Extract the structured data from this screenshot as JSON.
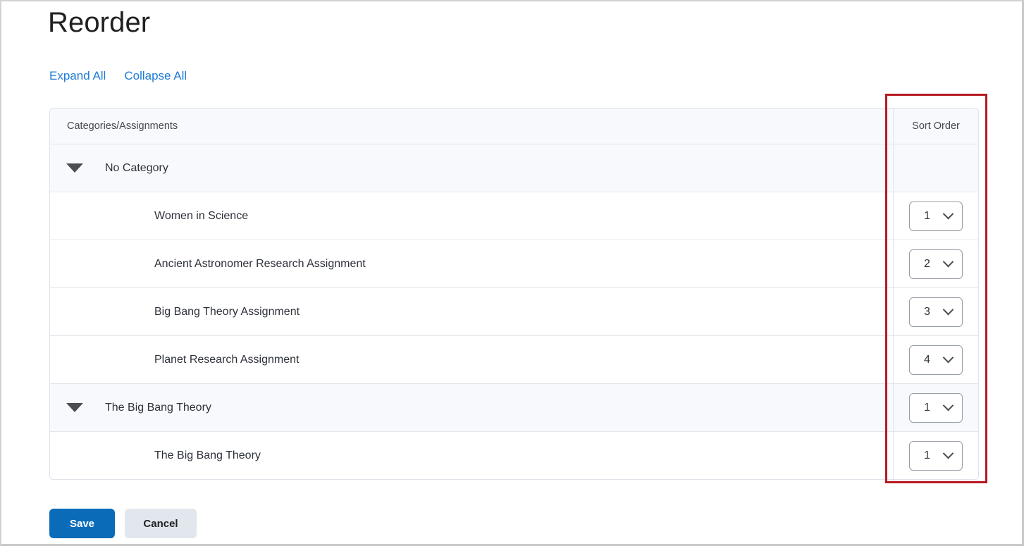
{
  "page": {
    "title": "Reorder"
  },
  "links": [
    {
      "label": "Expand All",
      "name": "expand-all-link"
    },
    {
      "label": "Collapse All",
      "name": "collapse-all-link"
    }
  ],
  "table": {
    "headers": {
      "name_column": "Categories/Assignments",
      "order_column": "Sort Order"
    },
    "rows": [
      {
        "type": "category",
        "label": "No Category",
        "sort_order": "",
        "has_select": false,
        "expanded": true
      },
      {
        "type": "assignment",
        "label": "Women in Science",
        "sort_order": "1",
        "has_select": true
      },
      {
        "type": "assignment",
        "label": "Ancient Astronomer Research Assignment",
        "sort_order": "2",
        "has_select": true
      },
      {
        "type": "assignment",
        "label": "Big Bang Theory Assignment",
        "sort_order": "3",
        "has_select": true
      },
      {
        "type": "assignment",
        "label": "Planet Research Assignment",
        "sort_order": "4",
        "has_select": true
      },
      {
        "type": "category",
        "label": "The Big Bang Theory",
        "sort_order": "1",
        "has_select": true,
        "expanded": true
      },
      {
        "type": "assignment",
        "label": "The Big Bang Theory",
        "sort_order": "1",
        "has_select": true
      }
    ]
  },
  "footer": {
    "save_label": "Save",
    "cancel_label": "Cancel"
  },
  "colors": {
    "link_blue": "#1e7ad6",
    "save_blue": "#0a6cb9",
    "cancel_gray": "#e2e7ee",
    "highlight_red": "#b51b23",
    "row_tint": "#f7f9fd",
    "border_gray": "#e2e6ec"
  }
}
